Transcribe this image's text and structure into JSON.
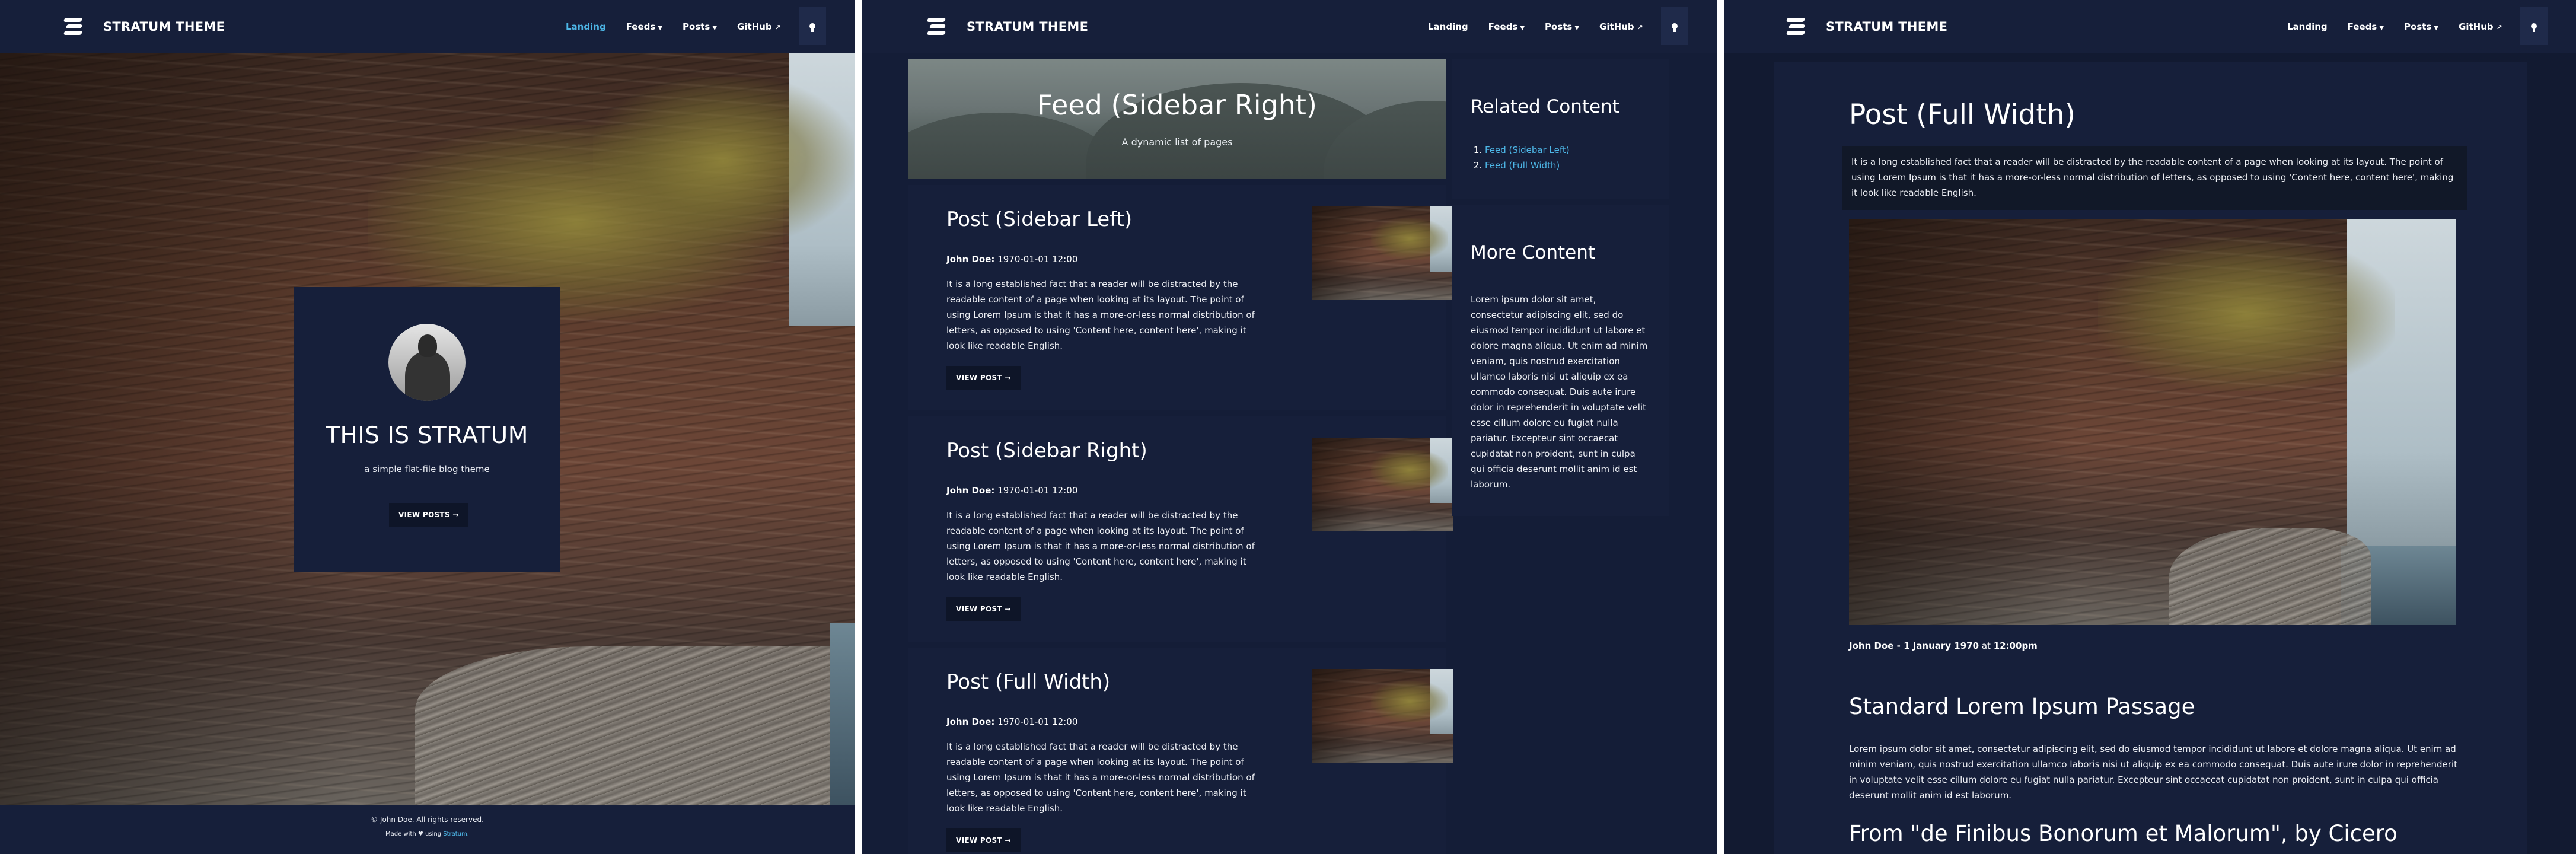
{
  "brand": {
    "name": "STRATUM THEME"
  },
  "nav": {
    "landing": "Landing",
    "feeds": "Feeds",
    "posts": "Posts",
    "github": "GitHub"
  },
  "landing": {
    "title": "THIS IS STRATUM",
    "subtitle": "a simple flat-file blog theme",
    "button": "VIEW POSTS →",
    "footer_copyright": "© John Doe. All rights reserved.",
    "footer_made_prefix": "Made with",
    "footer_made_using": "using",
    "footer_link": "Stratum."
  },
  "feed": {
    "title": "Feed (Sidebar Right)",
    "subtitle": "A dynamic list of pages",
    "posts": [
      {
        "title": "Post (Sidebar Left)",
        "author": "John Doe:",
        "date": "1970-01-01 12:00",
        "excerpt": "It is a long established fact that a reader will be distracted by the readable content of a page when looking at its layout. The point of using Lorem Ipsum is that it has a more-or-less normal distribution of letters, as opposed to using 'Content here, content here', making it look like readable English.",
        "button": "VIEW POST →"
      },
      {
        "title": "Post (Sidebar Right)",
        "author": "John Doe:",
        "date": "1970-01-01 12:00",
        "excerpt": "It is a long established fact that a reader will be distracted by the readable content of a page when looking at its layout. The point of using Lorem Ipsum is that it has a more-or-less normal distribution of letters, as opposed to using 'Content here, content here', making it look like readable English.",
        "button": "VIEW POST →"
      },
      {
        "title": "Post (Full Width)",
        "author": "John Doe:",
        "date": "1970-01-01 12:00",
        "excerpt": "It is a long established fact that a reader will be distracted by the readable content of a page when looking at its layout. The point of using Lorem Ipsum is that it has a more-or-less normal distribution of letters, as opposed to using 'Content here, content here', making it look like readable English.",
        "button": "VIEW POST →"
      }
    ],
    "related": {
      "title": "Related Content",
      "links": [
        "Feed (Sidebar Left)",
        "Feed (Full Width)"
      ]
    },
    "more": {
      "title": "More Content",
      "text": "Lorem ipsum dolor sit amet, consectetur adipiscing elit, sed do eiusmod tempor incididunt ut labore et dolore magna aliqua. Ut enim ad minim veniam, quis nostrud exercitation ullamco laboris nisi ut aliquip ex ea commodo consequat. Duis aute irure dolor in reprehenderit in voluptate velit esse cillum dolore eu fugiat nulla pariatur. Excepteur sint occaecat cupidatat non proident, sunt in culpa qui officia deserunt mollit anim id est laborum."
    }
  },
  "post": {
    "title": "Post (Full Width)",
    "lead": "It is a long established fact that a reader will be distracted by the readable content of a page when looking at its layout. The point of using Lorem Ipsum is that it has a more-or-less normal distribution of letters, as opposed to using 'Content here, content here', making it look like readable English.",
    "author_date": "John Doe - 1 January 1970",
    "at": "at",
    "time": "12:00pm",
    "h2": "Standard Lorem Ipsum Passage",
    "paragraph": "Lorem ipsum dolor sit amet, consectetur adipiscing elit, sed do eiusmod tempor incididunt ut labore et dolore magna aliqua. Ut enim ad minim veniam, quis nostrud exercitation ullamco laboris nisi ut aliquip ex ea commodo consequat. Duis aute irure dolor in reprehenderit in voluptate velit esse cillum dolore eu fugiat nulla pariatur. Excepteur sint occaecat cupidatat non proident, sunt in culpa qui officia deserunt mollit anim id est laborum.",
    "h2b": "From \"de Finibus Bonorum et Malorum\", by Cicero"
  },
  "colors": {
    "background": "#131c35",
    "card": "#161f3a",
    "accent": "#4db6e6",
    "button": "#0e1528"
  },
  "icons": [
    "stratum-logo-icon",
    "caret-down-icon",
    "external-link-icon",
    "lightbulb-icon",
    "heart-icon",
    "right-arrow-icon"
  ]
}
